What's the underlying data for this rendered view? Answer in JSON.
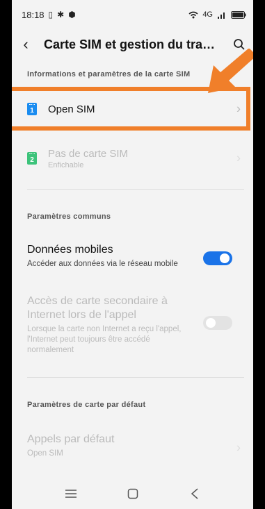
{
  "statusbar": {
    "time": "18:18",
    "network": "4G"
  },
  "header": {
    "title": "Carte SIM et gestion du trafic..."
  },
  "sections": {
    "sim_info": "Informations et paramètres de la carte SIM",
    "common": "Paramètres communs",
    "default": "Paramètres de carte par défaut"
  },
  "sim1": {
    "number": "1",
    "label": "Open SIM",
    "color": "#1a8cf0"
  },
  "sim2": {
    "number": "2",
    "label": "Pas de carte SIM",
    "sub": "Enfichable",
    "color": "#3cc37a"
  },
  "mobile_data": {
    "title": "Données mobiles",
    "desc": "Accéder aux données via le réseau mobile",
    "enabled": true
  },
  "secondary_access": {
    "title": "Accès de carte secondaire à Internet lors de l'appel",
    "desc": "Lorsque la carte non Internet a reçu l'appel, l'Internet peut toujours être accédé normalement",
    "enabled": false
  },
  "default_calls": {
    "title": "Appels par défaut",
    "value": "Open SIM"
  },
  "colors": {
    "accent": "#1a73e8",
    "highlight": "#f07f2a"
  }
}
